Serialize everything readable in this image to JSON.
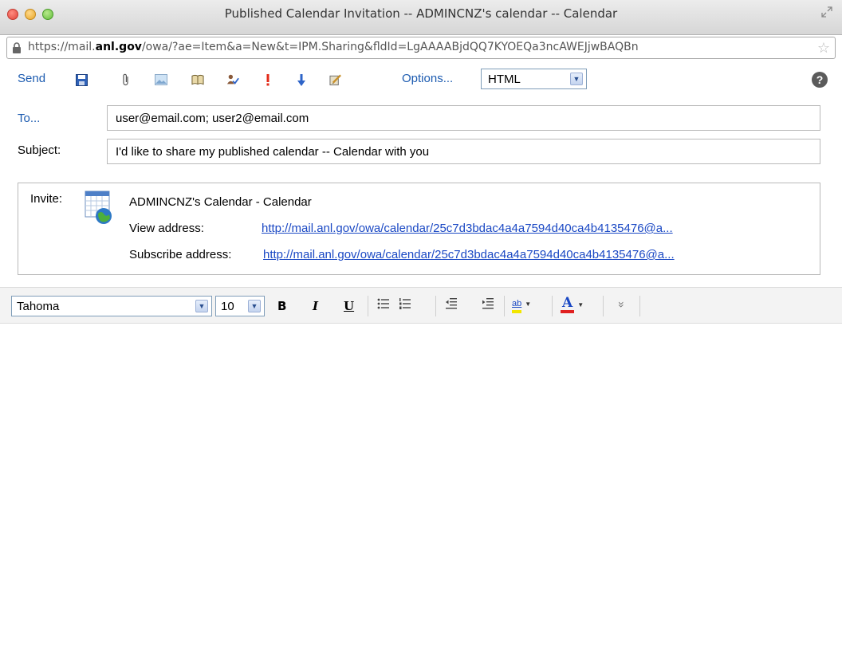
{
  "window": {
    "title": "Published Calendar Invitation -- ADMINCNZ's calendar -- Calendar",
    "url_prefix": "https://mail.",
    "url_domain": "anl.gov",
    "url_rest": "/owa/?ae=Item&a=New&t=IPM.Sharing&fldId=LgAAAABjdQQ7KYOEQa3ncAWEJjwBAQBn"
  },
  "toolbar": {
    "send_label": "Send",
    "options_label": "Options...",
    "format_value": "HTML",
    "icons": [
      "save-icon",
      "attach-icon",
      "insert-image-icon",
      "address-book-icon",
      "check-names-icon",
      "high-importance-icon",
      "low-importance-icon",
      "spell-check-icon"
    ]
  },
  "header": {
    "to_label": "To...",
    "to_value": "user@email.com; user2@email.com",
    "subject_label": "Subject:",
    "subject_value": "I'd like to share my published calendar -- Calendar with you"
  },
  "invite": {
    "label": "Invite:",
    "calendar_name": "ADMINCNZ's Calendar - Calendar",
    "view_label": "View address:",
    "view_url": "http://mail.anl.gov/owa/calendar/25c7d3bdac4a4a7594d40ca4b4135476@a...",
    "subscribe_label": "Subscribe address:",
    "subscribe_url": "http://mail.anl.gov/owa/calendar/25c7d3bdac4a4a7594d40ca4b4135476@a..."
  },
  "format": {
    "font_value": "Tahoma",
    "size_value": "10",
    "bold": "B",
    "italic": "I",
    "underline": "U",
    "highlight_glyph": "ab",
    "font_color_glyph": "A",
    "more_glyph": "»",
    "highlight_color": "#f2e600",
    "font_color": "#e02020"
  },
  "colors": {
    "link": "#1c5bb0",
    "accent_border": "#7f9db9"
  }
}
